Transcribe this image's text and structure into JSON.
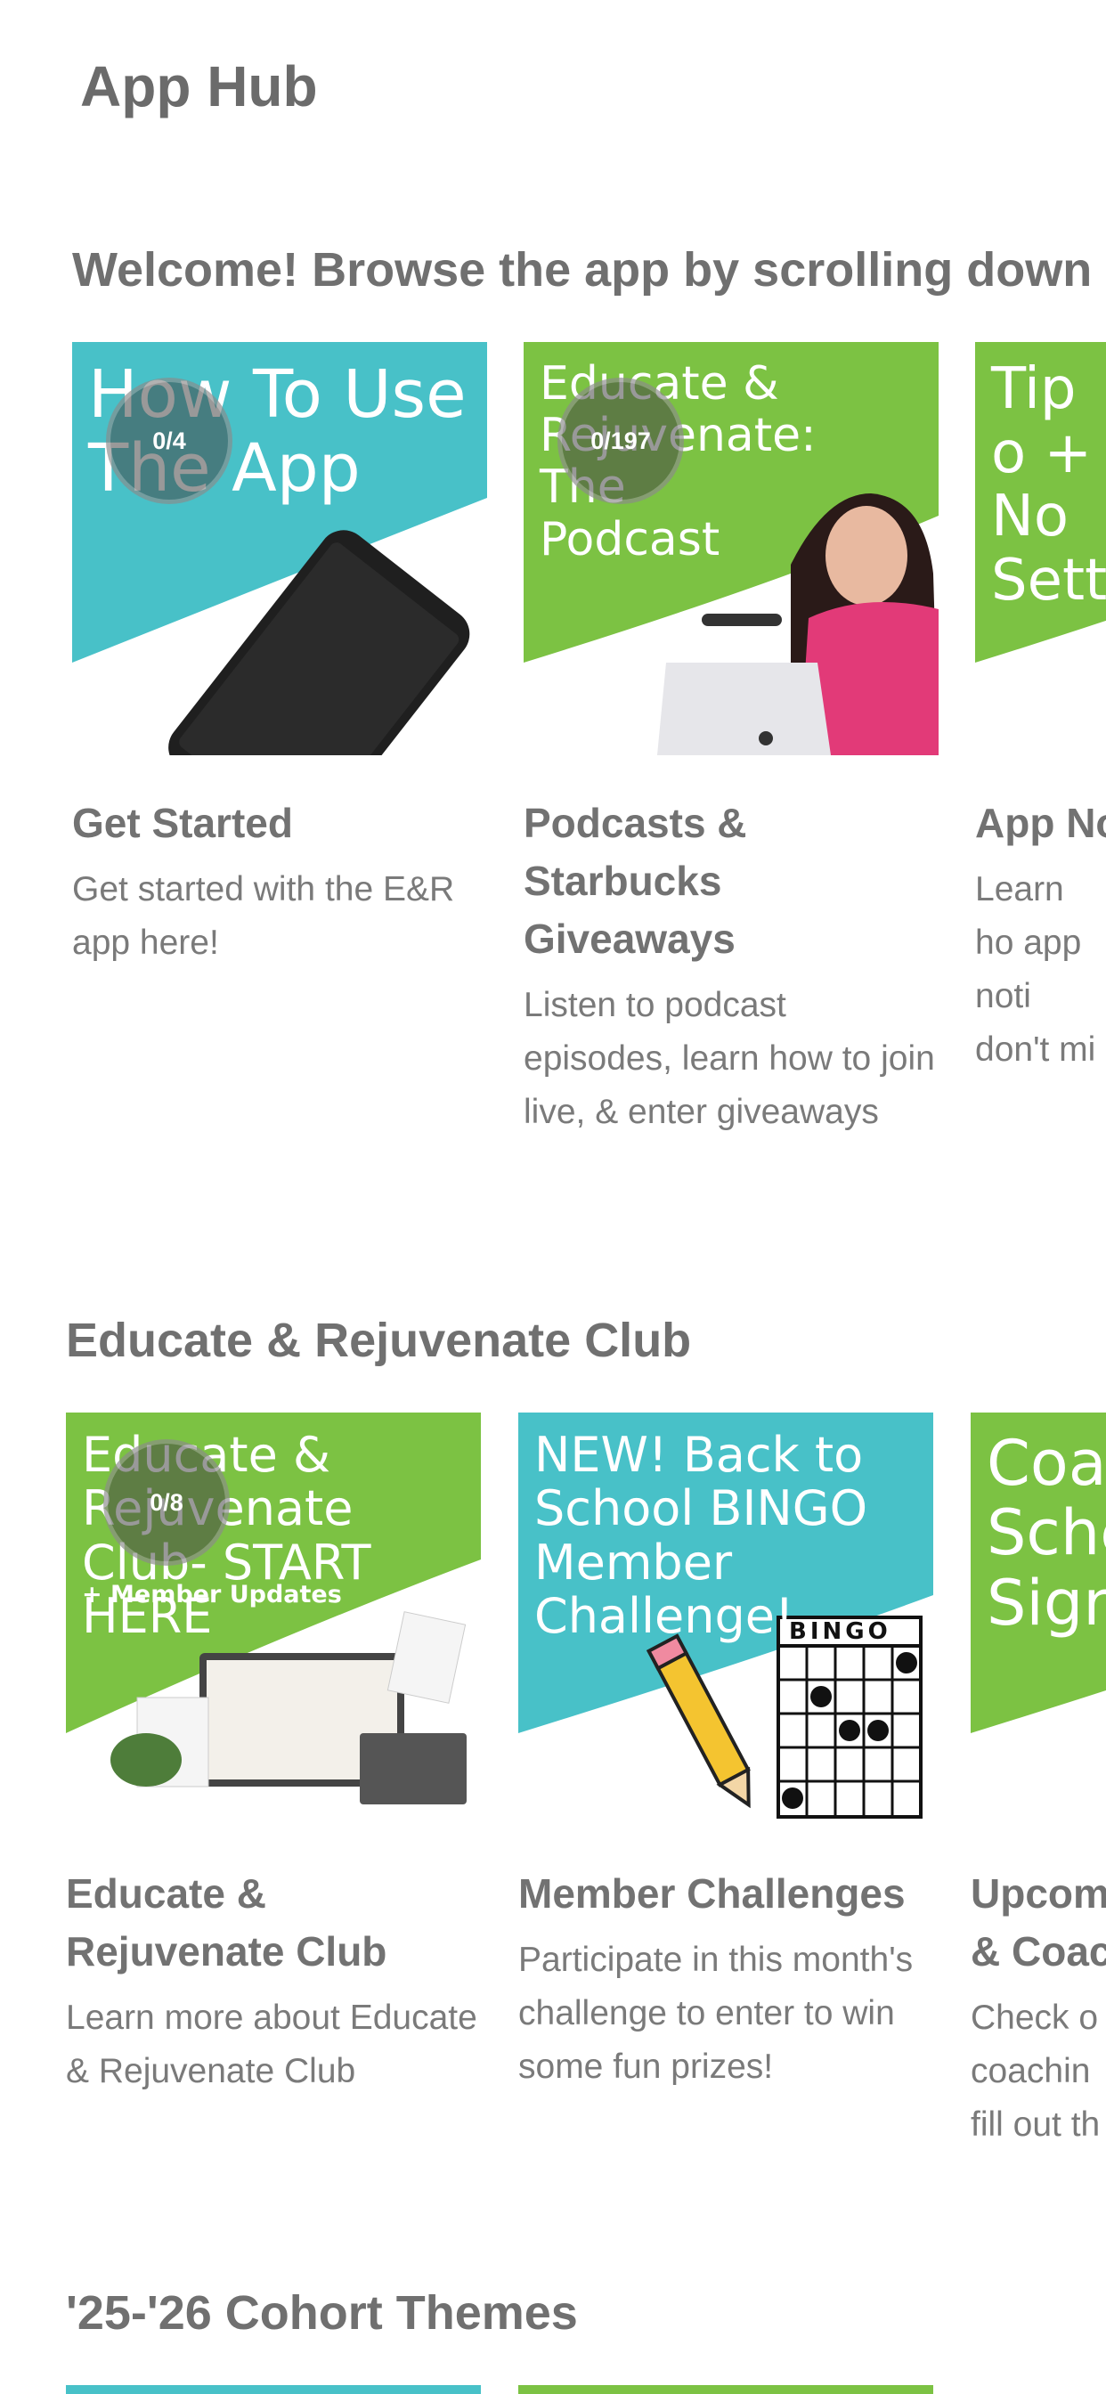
{
  "header": {
    "title": "App Hub"
  },
  "sections": [
    {
      "title": "Welcome! Browse the app by scrolling down &",
      "cards": [
        {
          "thumb_text": "How To Use The App",
          "badge": "0/4",
          "title": "Get Started",
          "desc": "Get started with the E&R app here!"
        },
        {
          "thumb_text": "Educate & Rejuvenate: The Podcast",
          "badge": "0/197",
          "title": "Podcasts & Starbucks Giveaways",
          "desc": "Listen to podcast episodes, learn how to join live, & enter giveaways"
        },
        {
          "thumb_text": "Tip o + No Settin",
          "title": "App No",
          "desc": "Learn ho app noti don't mi"
        }
      ]
    },
    {
      "title": "Educate & Rejuvenate Club",
      "cards": [
        {
          "thumb_text": "Educate & Rejuvenate Club- START HERE",
          "thumb_sub": "+ Member Updates",
          "badge": "0/8",
          "title": "Educate & Rejuvenate Club",
          "desc": "Learn more about Educate & Rejuvenate Club"
        },
        {
          "thumb_text": "NEW! Back to School BINGO Member Challenge!",
          "bingo_label": "BINGO",
          "title": "Member Challenges",
          "desc": "Participate in this month's challenge to enter to win some fun prizes!"
        },
        {
          "thumb_text": "Coa Sche Sign",
          "title": "Upcom & Coac",
          "desc": "Check o coachin fill out th"
        }
      ]
    },
    {
      "title": "'25-'26 Cohort Themes"
    }
  ],
  "colors": {
    "teal": "#48c1c8",
    "green": "#7cc243",
    "text_dark": "#6b6b6b"
  }
}
